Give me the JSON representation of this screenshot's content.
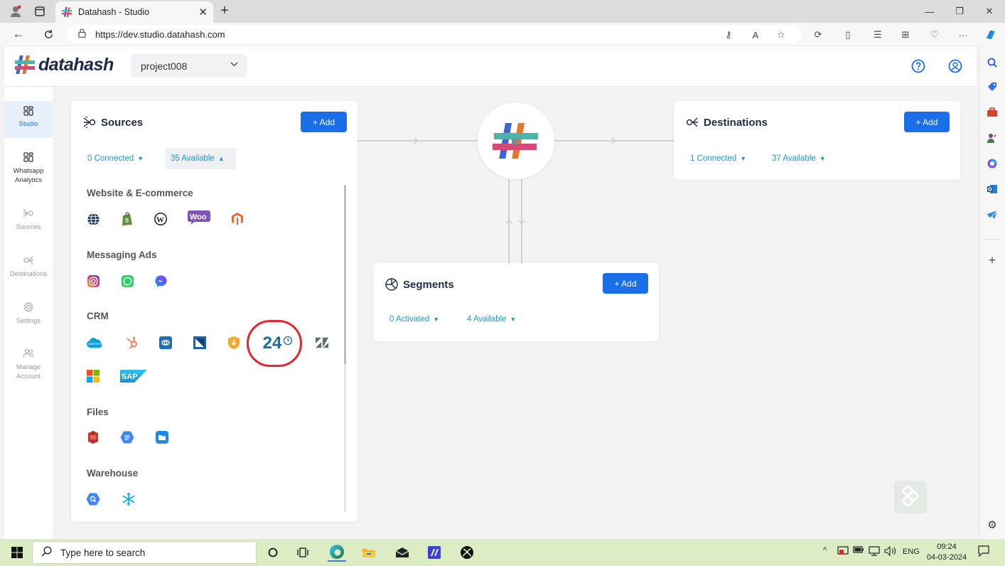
{
  "browser": {
    "tab_title": "Datahash - Studio",
    "tab_close": "✕",
    "new_tab": "+",
    "url": "https://dev.studio.datahash.com",
    "window_controls": [
      "—",
      "❐",
      "✕"
    ]
  },
  "app": {
    "logo_text": "datahash",
    "project": "project008",
    "sidebar": [
      {
        "label": "Studio",
        "icon": "grid-icon",
        "active": true
      },
      {
        "label": "Whatsapp Analytics",
        "icon": "grid-icon"
      },
      {
        "label": "Sources",
        "icon": "sources-icon"
      },
      {
        "label": "Destinations",
        "icon": "destinations-icon"
      },
      {
        "label": "Settings",
        "icon": "gear-icon"
      },
      {
        "label": "Manage Account",
        "icon": "users-icon"
      }
    ],
    "sources": {
      "title": "Sources",
      "add_label": "+ Add",
      "connected": "0 Connected",
      "available": "35 Available",
      "sections": [
        {
          "title": "Website & E-commerce",
          "icons": [
            "globe-icon",
            "shopify-icon",
            "wordpress-icon",
            "woocommerce-icon",
            "magento-icon"
          ]
        },
        {
          "title": "Messaging Ads",
          "icons": [
            "instagram-icon",
            "whatsapp-icon",
            "messenger-icon"
          ]
        },
        {
          "title": "CRM",
          "icons": [
            "salesforce-icon",
            "hubspot-icon",
            "zoho-icon",
            "freshworks-icon",
            "leadsquared-icon",
            "bitrix24-icon",
            "zendesk-icon",
            "microsoft-icon",
            "sap-icon"
          ]
        },
        {
          "title": "Files",
          "icons": [
            "aws-s3-icon",
            "google-docs-icon",
            "files-icon"
          ]
        },
        {
          "title": "Warehouse",
          "icons": [
            "bigquery-icon",
            "snowflake-icon"
          ]
        }
      ],
      "bitrix_label": "24"
    },
    "destinations": {
      "title": "Destinations",
      "add_label": "+ Add",
      "connected": "1 Connected",
      "available": "37 Available"
    },
    "segments": {
      "title": "Segments",
      "add_label": "+ Add",
      "activated": "0 Activated",
      "available": "4 Available"
    }
  },
  "taskbar": {
    "search_placeholder": "Type here to search",
    "lang": "ENG",
    "time": "09:24",
    "date": "04-03-2024"
  },
  "colors": {
    "accent": "#1a6fe8",
    "pill_text": "#1a9ad6",
    "highlight": "#e8242f",
    "taskbar": "#dcedc6"
  }
}
